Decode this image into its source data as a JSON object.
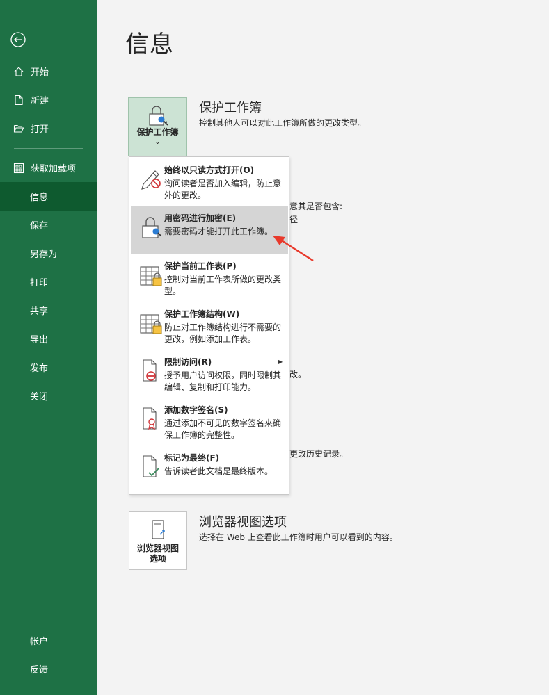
{
  "sidebar": {
    "items": [
      {
        "label": "开始",
        "icon": "home-icon"
      },
      {
        "label": "新建",
        "icon": "new-document-icon"
      },
      {
        "label": "打开",
        "icon": "open-folder-icon"
      },
      {
        "label": "获取加载项",
        "icon": "addins-grid-icon"
      },
      {
        "label": "信息"
      },
      {
        "label": "保存"
      },
      {
        "label": "另存为"
      },
      {
        "label": "打印"
      },
      {
        "label": "共享"
      },
      {
        "label": "导出"
      },
      {
        "label": "发布"
      },
      {
        "label": "关闭"
      }
    ],
    "bottom_items": [
      {
        "label": "帐户"
      },
      {
        "label": "反馈"
      }
    ],
    "active": "信息",
    "color": "#1e7145",
    "active_color": "#0e5a2f"
  },
  "main": {
    "title": "信息",
    "protect": {
      "tile_label": "保护工作簿",
      "tile_chevron": "⌄",
      "title": "保护工作簿",
      "desc": "控制其他人可以对此工作簿所做的更改类型。"
    },
    "hidden_fragments": {
      "f1": "意其是否包含:",
      "f2": "径",
      "f3": "改。",
      "f4": "更改历史记录。"
    },
    "browser": {
      "tile_label_line1": "浏览器视图",
      "tile_label_line2": "选项",
      "title": "浏览器视图选项",
      "desc": "选择在 Web 上查看此工作簿时用户可以看到的内容。"
    }
  },
  "dropdown": {
    "items": [
      {
        "title": "始终以只读方式打开(O)",
        "desc": "询问读者是否加入编辑，防止意外的更改。",
        "icon": "pencil-no-icon"
      },
      {
        "title": "用密码进行加密(E)",
        "desc": "需要密码才能打开此工作簿。",
        "icon": "lock-key-icon"
      },
      {
        "title": "保护当前工作表(P)",
        "desc": "控制对当前工作表所做的更改类型。",
        "icon": "sheet-lock-icon"
      },
      {
        "title": "保护工作簿结构(W)",
        "desc": "防止对工作簿结构进行不需要的更改，例如添加工作表。",
        "icon": "workbook-lock-icon"
      },
      {
        "title": "限制访问(R)",
        "desc": "授予用户访问权限，同时限制其编辑、复制和打印能力。",
        "icon": "restrict-access-icon",
        "submenu": "▶"
      },
      {
        "title": "添加数字签名(S)",
        "desc": "通过添加不可见的数字签名来确保工作簿的完整性。",
        "icon": "digital-signature-icon"
      },
      {
        "title": "标记为最终(F)",
        "desc": "告诉读者此文档是最终版本。",
        "icon": "mark-final-icon"
      }
    ],
    "highlighted_index": 1,
    "highlight_color": "#d5d5d5"
  },
  "annotation": {
    "color": "#e8392b"
  }
}
